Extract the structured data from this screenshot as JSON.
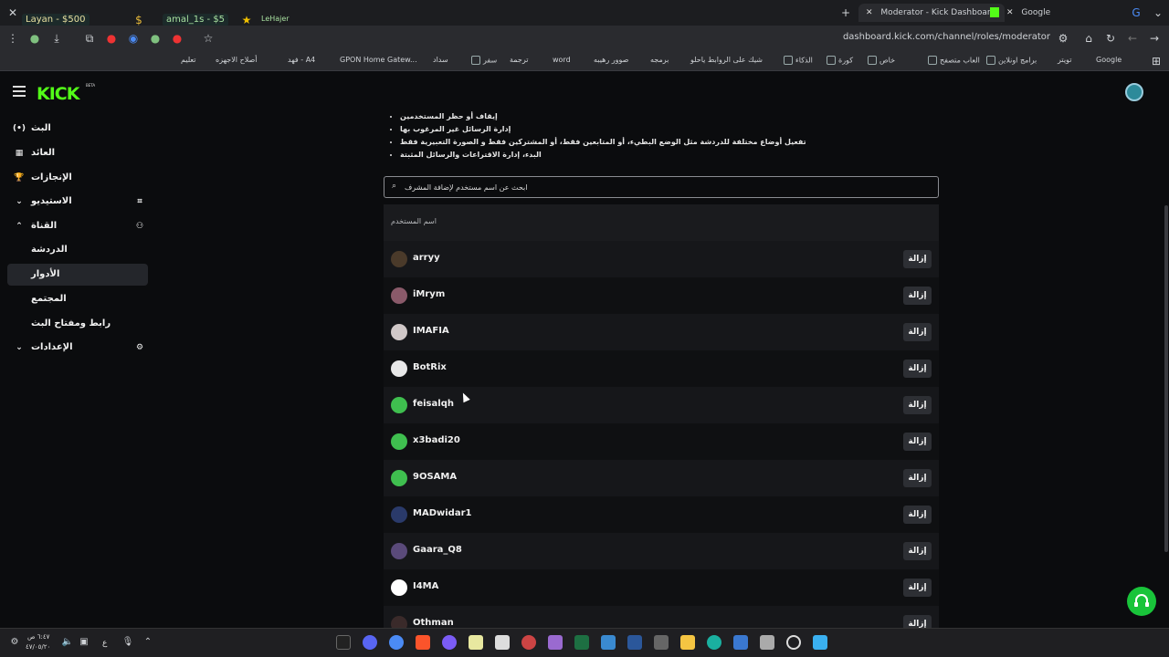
{
  "browser": {
    "tabs": [
      {
        "title": "Moderator - Kick Dashboard",
        "active": true
      },
      {
        "title": "Google",
        "active": false
      }
    ],
    "url": "dashboard.kick.com/channel/roles/moderator",
    "overlay_chips": [
      "Layan - $500",
      "amal_1s - $5",
      "LeHajer"
    ],
    "bookmarks": [
      "Google",
      "تويتر",
      "برامج اونلاين",
      "العاب متصفح",
      "خاص",
      "كورة",
      "الذكاء",
      "شيك على الروابط ياحلو",
      "برمجه",
      "صوور رهيبه",
      "word",
      "ترجمة",
      "سفر",
      "سداد",
      "GPON Home Gatew...",
      "فهد - A4",
      "أصلاح الاجهزه",
      "تعليم"
    ]
  },
  "topbar": {
    "logo": "KICK",
    "beta": "BETA"
  },
  "sidebar": {
    "items": [
      {
        "label": "البث",
        "icon": "broadcast-icon",
        "lead": "(•)",
        "active": false
      },
      {
        "label": "العائد",
        "icon": "revenue-icon",
        "lead": "▦",
        "active": false
      },
      {
        "label": "الإنجازات",
        "icon": "trophy-icon",
        "lead": "🏆",
        "active": false
      },
      {
        "label": "الاستيديو",
        "icon": "studio-icon",
        "lead": "⌄",
        "trail": "⌗",
        "active": false
      },
      {
        "label": "القناة",
        "icon": "channel-icon",
        "lead": "⌃",
        "trail": "⚇",
        "active": false
      },
      {
        "label": "الدردشة",
        "sub": true,
        "active": false
      },
      {
        "label": "الأدوار",
        "sub": true,
        "active": true
      },
      {
        "label": "المجتمع",
        "sub": true,
        "active": false
      },
      {
        "label": "رابط ومفتاح البث",
        "sub": true,
        "active": false
      },
      {
        "label": "الإعدادات",
        "icon": "settings-icon",
        "lead": "⌄",
        "trail": "⚙",
        "active": false
      }
    ]
  },
  "main": {
    "bullets": [
      "إيقاف أو حظر المستخدمين",
      "إدارة الرسائل غير المرغوب بها",
      "تفعيل أوضاع مختلفة للدردشة مثل الوضع البطيء، أو المتابعين فقط، أو المشتركين فقط و الصورة التعبيرية فقط",
      "البدء، إدارة الاقتراعات والرسائل المثبتة"
    ],
    "search_placeholder": "ابحث عن اسم مستخدم لإضافة المشرف",
    "table_header": "اسم المستخدم",
    "remove_label": "إزالة",
    "moderators": [
      {
        "username": "arryy",
        "avatar_color": "#4a3a2a"
      },
      {
        "username": "iMrym",
        "avatar_color": "#8a5a6a"
      },
      {
        "username": "IMAFIA",
        "avatar_color": "#d0c8c8"
      },
      {
        "username": "BotRix",
        "avatar_color": "#e8e8e8"
      },
      {
        "username": "feisalqh",
        "avatar_color": "#3fbf4f"
      },
      {
        "username": "x3badi20",
        "avatar_color": "#3fbf4f"
      },
      {
        "username": "9OSAMA",
        "avatar_color": "#3fbf4f"
      },
      {
        "username": "MADwidar1",
        "avatar_color": "#2a3a6a"
      },
      {
        "username": "Gaara_Q8",
        "avatar_color": "#5a4a7a"
      },
      {
        "username": "I4MA",
        "avatar_color": "#ffffff"
      },
      {
        "username": "Othman",
        "avatar_color": "#3a2a2a"
      }
    ]
  },
  "taskbar": {
    "time": "٦:٤٧ ص",
    "date": "٤٧/٠٥/٢٠",
    "lang": "ع"
  }
}
